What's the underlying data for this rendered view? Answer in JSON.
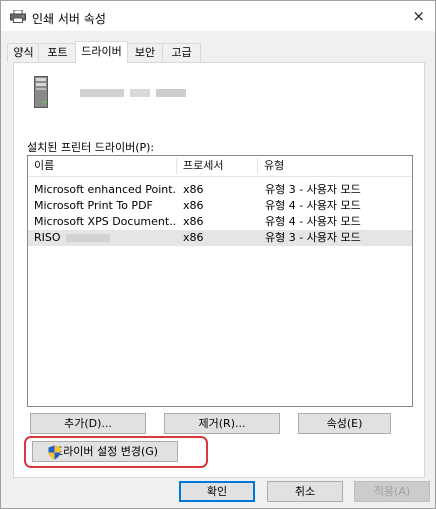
{
  "window": {
    "title": "인쇄 서버 속성",
    "close_glyph": "×"
  },
  "tabs": [
    {
      "label": "양식",
      "active": false
    },
    {
      "label": "포트",
      "active": false
    },
    {
      "label": "드라이버",
      "active": true
    },
    {
      "label": "보안",
      "active": false
    },
    {
      "label": "고급",
      "active": false
    }
  ],
  "panel": {
    "server_icon": "server-tower-icon",
    "list_label": "설치된 프린터 드라이버(P):",
    "columns": [
      "이름",
      "프로세서",
      "유형"
    ],
    "drivers": [
      {
        "name": "Microsoft enhanced Point...",
        "processor": "x86",
        "type": "유형 3 - 사용자 모드",
        "selected": false
      },
      {
        "name": "Microsoft Print To PDF",
        "processor": "x86",
        "type": "유형 4 - 사용자 모드",
        "selected": false
      },
      {
        "name": "Microsoft XPS Document...",
        "processor": "x86",
        "type": "유형 4 - 사용자 모드",
        "selected": false
      },
      {
        "name": "RISO",
        "processor": "x86",
        "type": "유형 3 - 사용자 모드",
        "selected": true
      }
    ],
    "buttons": {
      "add": "추가(D)...",
      "remove": "제거(R)...",
      "properties": "속성(E)",
      "change_settings": "드라이버 설정 변경(G)"
    }
  },
  "footer": {
    "ok": "확인",
    "cancel": "취소",
    "apply": "적용(A)"
  },
  "colors": {
    "highlight": "#d9393c",
    "focus_border": "#0078d7",
    "selected_row": "#e5e5e5"
  }
}
